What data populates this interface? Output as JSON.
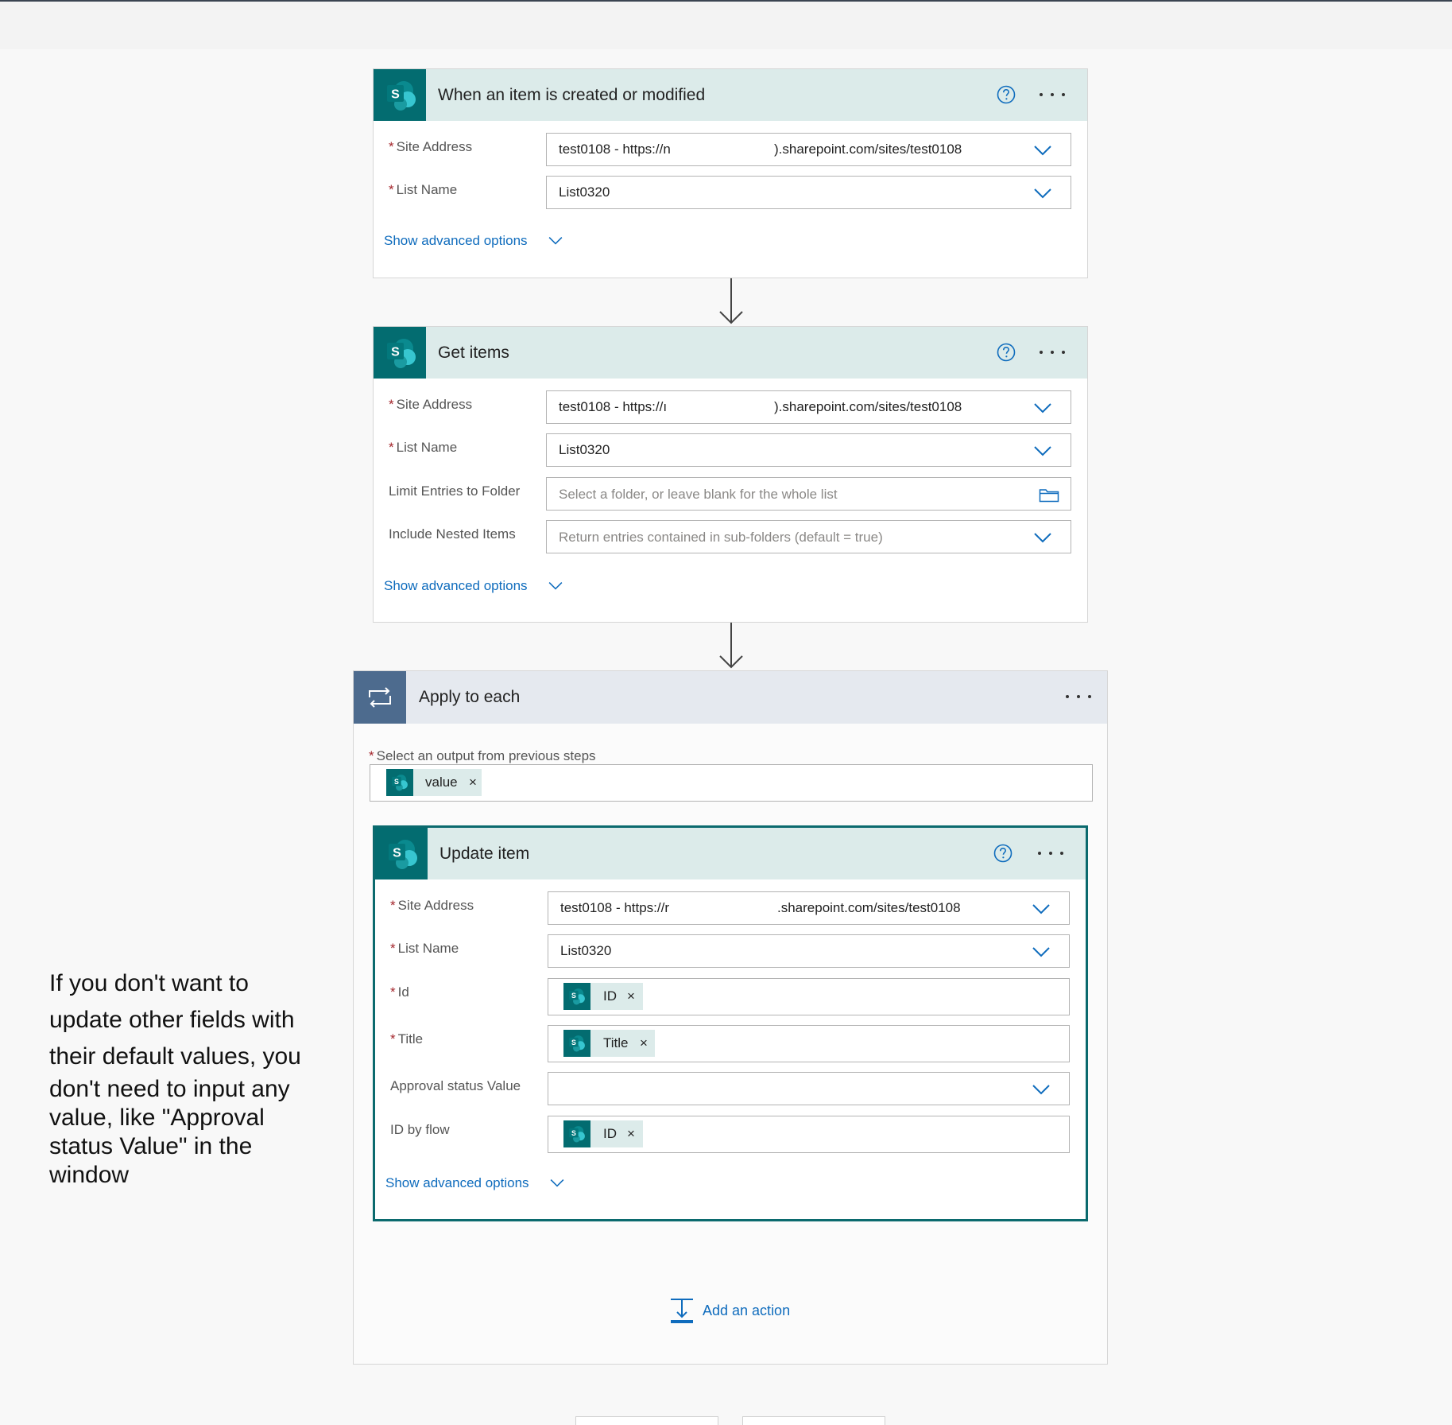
{
  "trigger": {
    "title": "When an item is created or modified",
    "site_label": "Site Address",
    "site_value_prefix": "test0108 - https://n",
    "site_value_suffix": ").sharepoint.com/sites/test0108",
    "list_label": "List Name",
    "list_value": "List0320",
    "advanced": "Show advanced options"
  },
  "get_items": {
    "title": "Get items",
    "site_label": "Site Address",
    "site_value_prefix": "test0108 - https://ı",
    "site_value_suffix": ").sharepoint.com/sites/test0108",
    "list_label": "List Name",
    "list_value": "List0320",
    "folder_label": "Limit Entries to Folder",
    "folder_placeholder": "Select a folder, or leave blank for the whole list",
    "nested_label": "Include Nested Items",
    "nested_placeholder": "Return entries contained in sub-folders (default = true)",
    "advanced": "Show advanced options"
  },
  "apply_each": {
    "title": "Apply to each",
    "select_label": "Select an output from previous steps",
    "token": "value",
    "token_remove": "×"
  },
  "update_item": {
    "title": "Update item",
    "site_label": "Site Address",
    "site_value_prefix": "test0108 - https://r",
    "site_value_suffix": ".sharepoint.com/sites/test0108",
    "list_label": "List Name",
    "list_value": "List0320",
    "id_label": "Id",
    "id_token": "ID",
    "title_label": "Title",
    "title_token": "Title",
    "approval_label": "Approval status Value",
    "idflow_label": "ID by flow",
    "idflow_token": "ID",
    "token_remove": "×",
    "advanced": "Show advanced options"
  },
  "add_action": "Add an action",
  "annotation": {
    "line1": "If you don't want to",
    "line2": "update other fields with",
    "line3": "their default values, you",
    "line4": "don't need to input any",
    "line5": "value, like \"Approval",
    "line6": "status Value\" in the",
    "line7": "window"
  },
  "colors": {
    "sharepoint_teal": "#036c70",
    "header_bg": "#dcebea",
    "link_blue": "#0f6cbd",
    "loop_tile": "#4d6b8e",
    "required": "#a4262c"
  },
  "icons": [
    "sharepoint-icon",
    "help-icon",
    "more-icon",
    "chevron-down-icon",
    "folder-icon",
    "loop-icon",
    "add-action-icon",
    "arrow-down-icon"
  ]
}
